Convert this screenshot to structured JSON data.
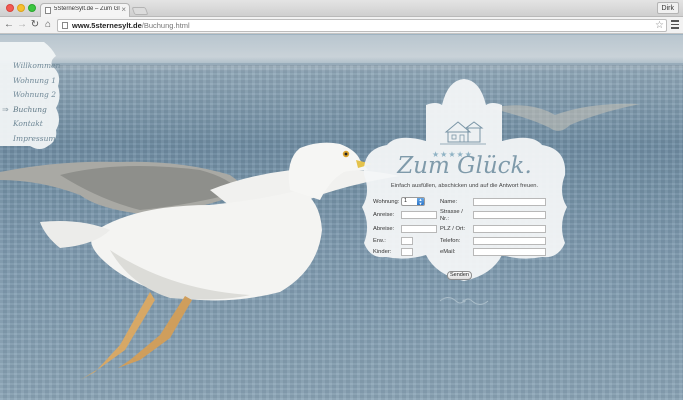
{
  "browser": {
    "tab_title": "5SterneSylt.de – Zum Glü",
    "tab_close": "×",
    "profile": "Dirk",
    "url_domain": "www.5sternesylt.de",
    "url_path": "/Buchung.html",
    "star": "☆"
  },
  "nav": {
    "back": "←",
    "forward": "→",
    "reload": "↻",
    "home": "⌂",
    "arrow": "⇒",
    "items": [
      {
        "label": "Willkommen"
      },
      {
        "label": "Wohnung 1"
      },
      {
        "label": "Wohnung 2"
      },
      {
        "label": "Buchung"
      },
      {
        "label": "Kontakt"
      },
      {
        "label": "Impressum"
      }
    ]
  },
  "form": {
    "stars": "★★★★★",
    "title": "Zum Glück.",
    "subtitle": "Einfach ausfüllen, abschicken und auf die Antwort freuen.",
    "labels": {
      "wohnung": "Wohnung:",
      "anreise": "Anreise:",
      "abreise": "Abreise:",
      "erw": "Erw.:",
      "kinder": "Kinder:",
      "name": "Name:",
      "strasse": "Strasse /",
      "strasse2": "Nr.:",
      "plz": "PLZ / Ort:",
      "telefon": "Telefon:",
      "email": "eMail:"
    },
    "wohnung_value": "1",
    "submit": "Senden"
  },
  "colors": {
    "nav_text": "#6e8796",
    "title": "#7f9aaa",
    "panel_bg": "#f3f6f7"
  }
}
